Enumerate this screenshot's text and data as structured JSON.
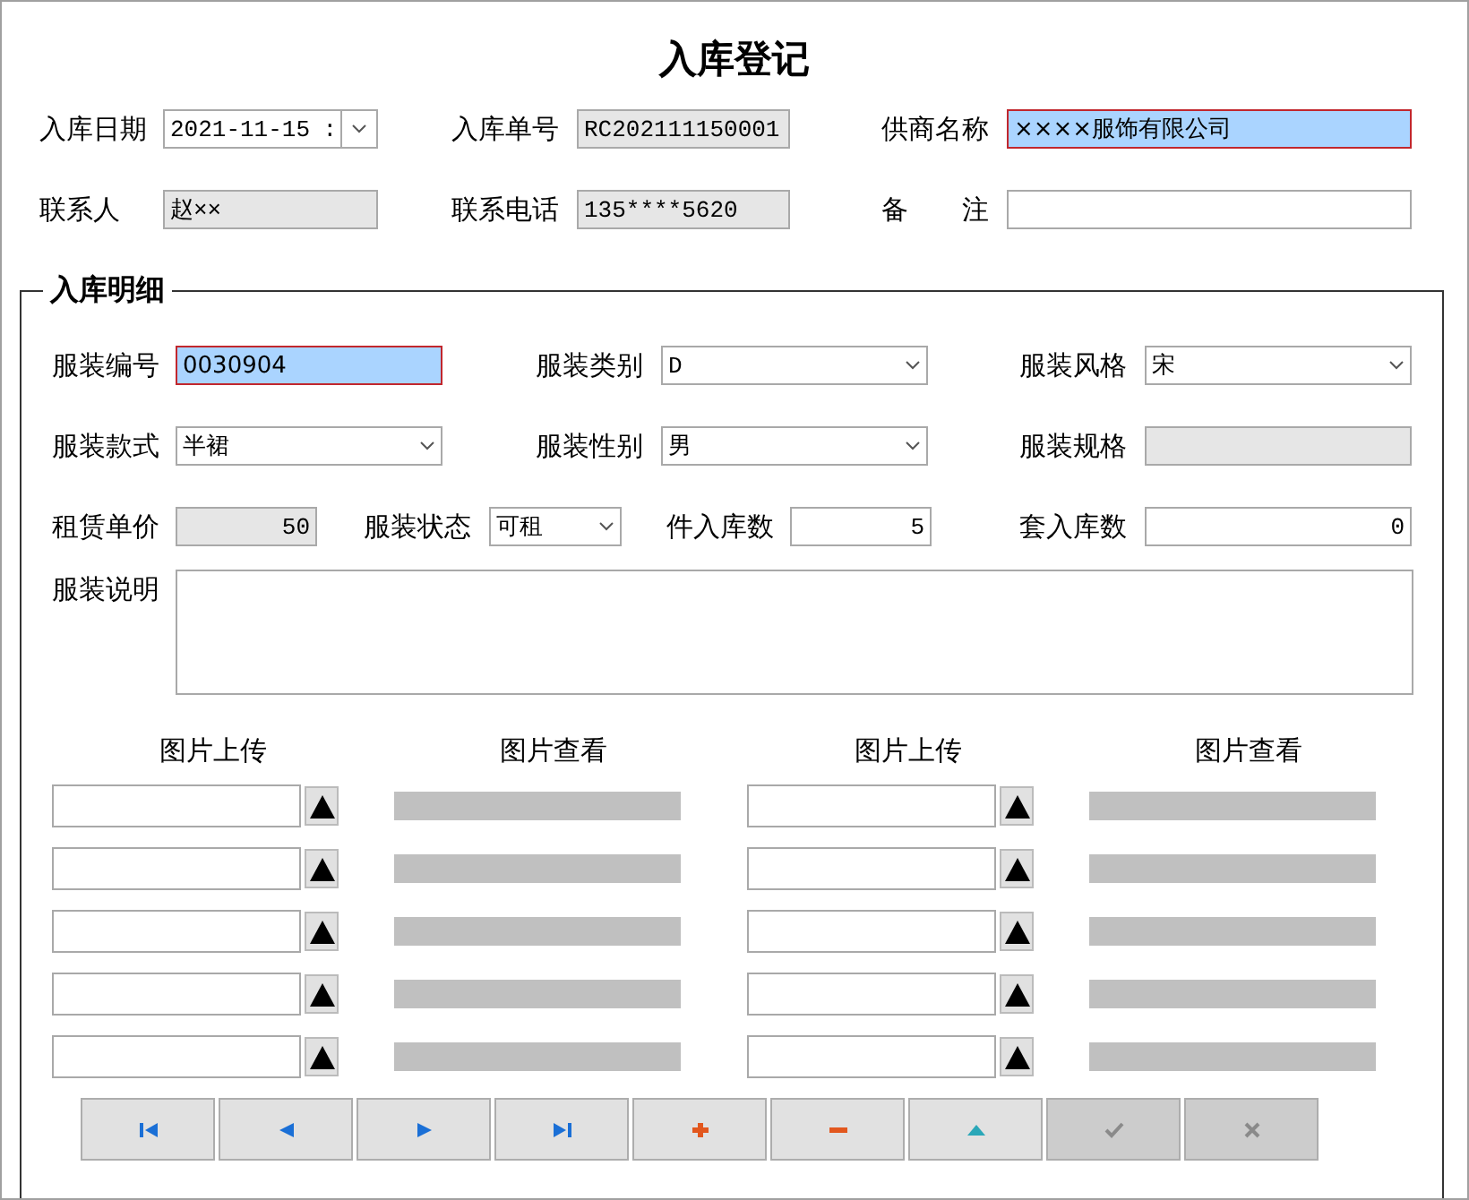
{
  "title": "入库登记",
  "header_rows": [
    [
      {
        "label": "入库日期",
        "value": "2021-11-15",
        "suffix": ":",
        "kind": "date",
        "focused": false
      },
      {
        "label": "入库单号",
        "value": "RC202111150001",
        "kind": "readonly",
        "focused": false
      },
      {
        "label": "供商名称",
        "value": "××××服饰有限公司",
        "kind": "text",
        "focused": true
      }
    ],
    [
      {
        "label": "联系人",
        "value": "赵××",
        "kind": "readonly",
        "focused": false
      },
      {
        "label": "联系电话",
        "value": "135****5620",
        "kind": "readonly",
        "focused": false
      },
      {
        "label": "备　　注",
        "kind": "text",
        "focused": false
      }
    ]
  ],
  "detail": {
    "legend": "入库明细",
    "rows": [
      [
        {
          "label": "服装编号",
          "value": "0030904",
          "kind": "text",
          "focused": true
        },
        {
          "label": "服装类别",
          "value": "D",
          "kind": "combo",
          "focused": false
        },
        {
          "label": "服装风格",
          "value": "宋",
          "kind": "combo",
          "focused": false
        }
      ],
      [
        {
          "label": "服装款式",
          "value": "半裙",
          "kind": "combo",
          "focused": false
        },
        {
          "label": "服装性别",
          "value": "男",
          "kind": "combo",
          "focused": false
        },
        {
          "label": "服装规格",
          "kind": "readonly",
          "focused": false
        }
      ],
      [
        {
          "label": "租赁单价",
          "value": "50",
          "kind": "readonly-number",
          "focused": false
        },
        {
          "label": "服装状态",
          "value": "可租",
          "kind": "combo",
          "focused": false
        },
        {
          "label": "件入库数",
          "value": "5",
          "kind": "number",
          "focused": false
        },
        {
          "label": "套入库数",
          "value": "0",
          "kind": "number",
          "focused": false
        }
      ]
    ],
    "description": {
      "label": "服装说明"
    },
    "photo_columns": [
      {
        "upload_label": "图片上传",
        "view_label": "图片查看",
        "slots": [
          {
            "kind": "empty"
          },
          {
            "kind": "empty"
          },
          {
            "kind": "empty"
          },
          {
            "kind": "empty"
          },
          {
            "kind": "empty"
          }
        ]
      },
      {
        "upload_label": "图片上传",
        "view_label": "图片查看",
        "slots": [
          {
            "kind": "empty"
          },
          {
            "kind": "empty"
          },
          {
            "kind": "empty"
          },
          {
            "kind": "empty"
          },
          {
            "kind": "empty"
          }
        ]
      }
    ]
  },
  "nav_buttons": [
    {
      "kind": "first",
      "disabled": false
    },
    {
      "kind": "prev",
      "disabled": false
    },
    {
      "kind": "next",
      "disabled": false
    },
    {
      "kind": "last",
      "disabled": false
    },
    {
      "kind": "add",
      "disabled": false
    },
    {
      "kind": "delete",
      "disabled": false
    },
    {
      "kind": "up",
      "disabled": false
    },
    {
      "kind": "confirm",
      "disabled": true
    },
    {
      "kind": "cancel",
      "disabled": true
    }
  ]
}
